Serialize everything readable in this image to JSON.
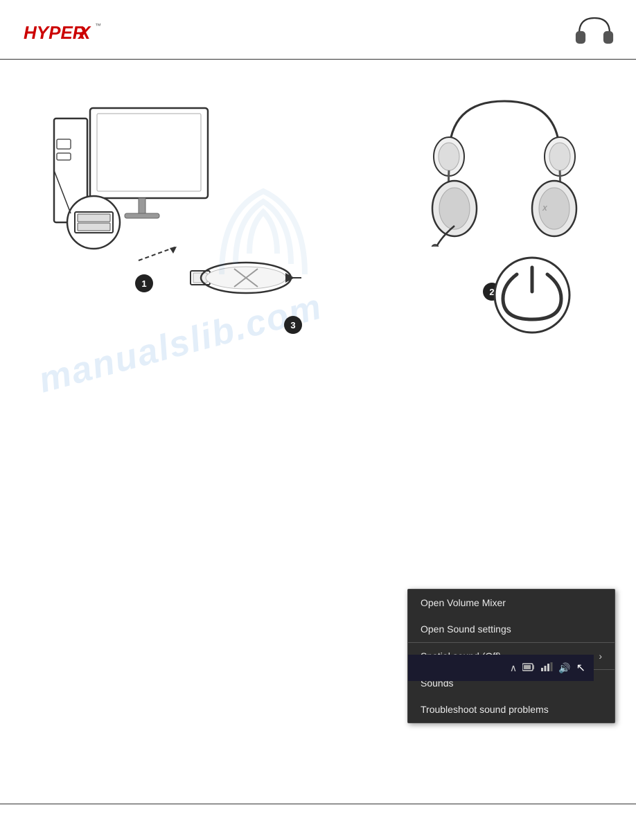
{
  "header": {
    "brand": "HYPER",
    "brand_x": "X",
    "brand_tm": "™",
    "headset_icon_label": "headset"
  },
  "watermark": {
    "text": "manualslib.com"
  },
  "steps": {
    "step1_label": "❶",
    "step2_label": "❷",
    "step3_label": "❸"
  },
  "context_menu": {
    "items": [
      {
        "label": "Open Volume Mixer",
        "has_arrow": false
      },
      {
        "label": "Open Sound settings",
        "has_arrow": false
      },
      {
        "label": "Spatial sound (Off)",
        "has_arrow": true
      },
      {
        "label": "Sounds",
        "has_arrow": false
      },
      {
        "label": "Troubleshoot sound problems",
        "has_arrow": false
      }
    ]
  },
  "taskbar": {
    "icons": [
      "^",
      "⊡",
      "⊞",
      "🔊"
    ]
  }
}
